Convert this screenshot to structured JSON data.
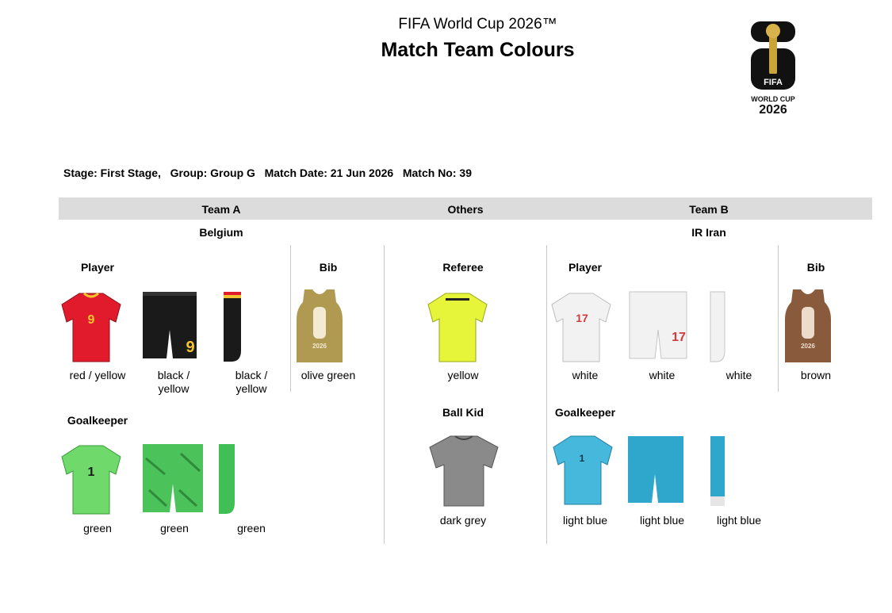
{
  "header": {
    "subtitle": "FIFA World Cup 2026™",
    "title": "Match Team Colours"
  },
  "logo": {
    "fifa": "FIFA",
    "world_cup": "WORLD CUP",
    "year": "2026"
  },
  "match_info": "Stage: First Stage,   Group: Group G   Match Date: 21 Jun 2026   Match No: 39",
  "columns": {
    "team_a": "Team A",
    "others": "Others",
    "team_b": "Team B"
  },
  "team_a": {
    "name": "Belgium",
    "player_label": "Player",
    "bib_label": "Bib",
    "gk_label": "Goalkeeper",
    "player": {
      "shirt": "red / yellow",
      "shorts": "black / yellow",
      "socks": "black / yellow"
    },
    "bib": "olive green",
    "gk": {
      "shirt": "green",
      "shorts": "green",
      "socks": "green"
    }
  },
  "others": {
    "referee_label": "Referee",
    "referee": "yellow",
    "ballkid_label": "Ball Kid",
    "ballkid": "dark grey"
  },
  "team_b": {
    "name": "IR Iran",
    "player_label": "Player",
    "bib_label": "Bib",
    "gk_label": "Goalkeeper",
    "player": {
      "shirt": "white",
      "shorts": "white",
      "socks": "white"
    },
    "bib": "brown",
    "gk": {
      "shirt": "light blue",
      "shorts": "light blue",
      "socks": "light blue"
    }
  },
  "colors": {
    "bel_shirt": "#e21b2c",
    "bel_shorts": "#1a1a1a",
    "bel_socks": "#1a1a1a",
    "bel_trim": "#f4c430",
    "olive": "#b09a52",
    "bel_gk": "#6fd96b",
    "ref": "#e6f53a",
    "ballkid": "#8a8a8a",
    "irn": "#f2f2f2",
    "brown": "#8a5a3c",
    "irn_gk": "#46b8dc"
  }
}
